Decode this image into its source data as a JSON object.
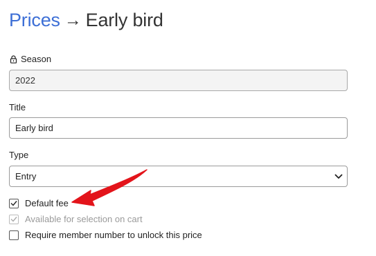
{
  "breadcrumb": {
    "parent_label": "Prices",
    "separator": "→",
    "current_label": "Early bird"
  },
  "season": {
    "label": "Season",
    "value": "2022",
    "locked_icon": "lock-icon"
  },
  "title_field": {
    "label": "Title",
    "value": "Early bird"
  },
  "type_field": {
    "label": "Type",
    "selected": "Entry",
    "icon": "chevron-down-icon"
  },
  "checkboxes": [
    {
      "label": "Default fee",
      "checked": true,
      "disabled": false
    },
    {
      "label": "Available for selection on cart",
      "checked": true,
      "disabled": true
    },
    {
      "label": "Require member number to unlock this price",
      "checked": false,
      "disabled": false
    }
  ],
  "colors": {
    "link": "#3d6fd6",
    "annotation_arrow": "#e3141b",
    "disabled_text": "#9a9a9a"
  }
}
